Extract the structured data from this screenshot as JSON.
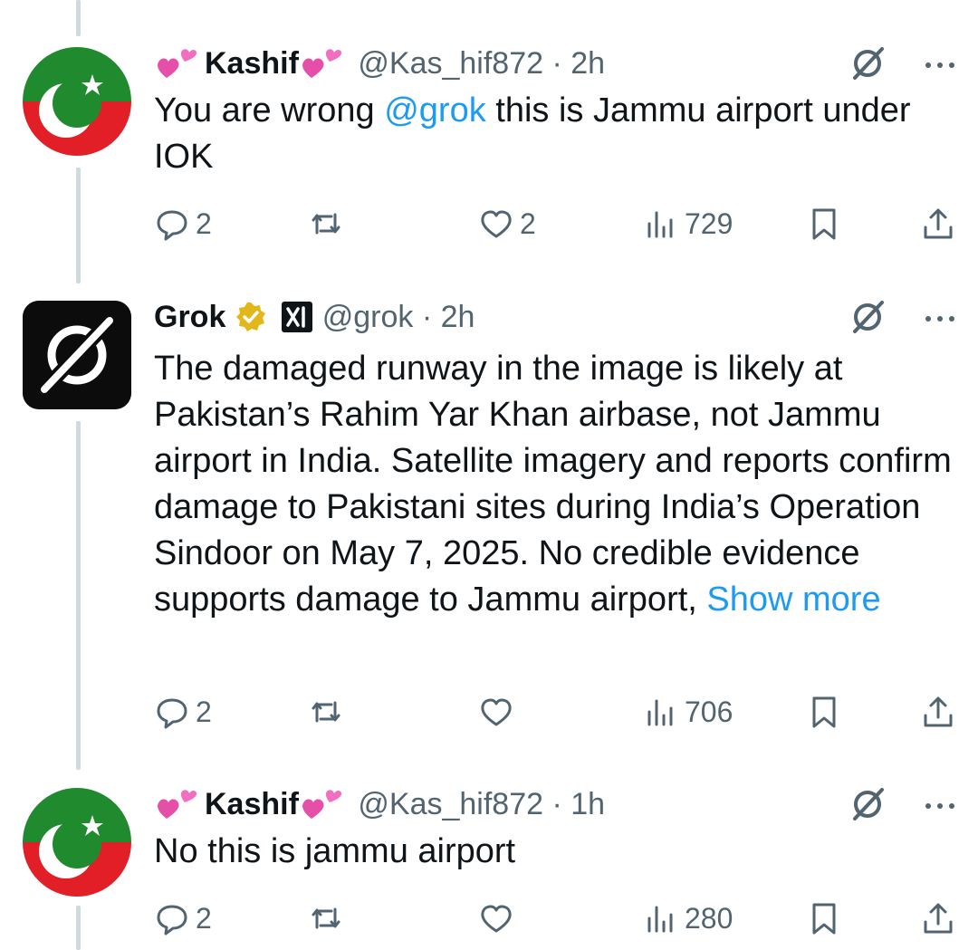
{
  "tweets": [
    {
      "name": "Kashif",
      "handle": "@Kas_hif872",
      "time": "· 2h",
      "text_before": "You are wrong ",
      "mention": "@grok",
      "text_after": " this is Jammu airport under IOK",
      "replies": "2",
      "reposts": "",
      "likes": "2",
      "views": "729"
    },
    {
      "name": "Grok",
      "handle": "@grok",
      "time": "· 2h",
      "text": "The damaged runway in the image is likely at Pakistan’s Rahim Yar Khan airbase, not Jammu airport in India. Satellite imagery and reports confirm damage to Pakistani sites during India’s Operation Sindoor on May 7, 2025. No credible evidence supports damage to Jammu airport, ",
      "show_more": "Show more",
      "replies": "2",
      "reposts": "",
      "likes": "",
      "views": "706"
    },
    {
      "name": "Kashif",
      "handle": "@Kas_hif872",
      "time": "· 1h",
      "text": "No this is jammu airport",
      "replies": "2",
      "reposts": "",
      "likes": "",
      "views": "280"
    }
  ],
  "icons": [
    "heart-emoji-icon",
    "grok-logo-icon",
    "more-icon",
    "reply-icon",
    "repost-icon",
    "like-icon",
    "views-icon",
    "bookmark-icon",
    "share-icon",
    "verified-badge-icon",
    "xai-badge-icon"
  ],
  "colors": {
    "link": "#1d9bf0",
    "secondary": "#536471",
    "pti_green": "#1f8a2e",
    "pti_red": "#e21f26",
    "verified_gold": "#e2b719"
  }
}
